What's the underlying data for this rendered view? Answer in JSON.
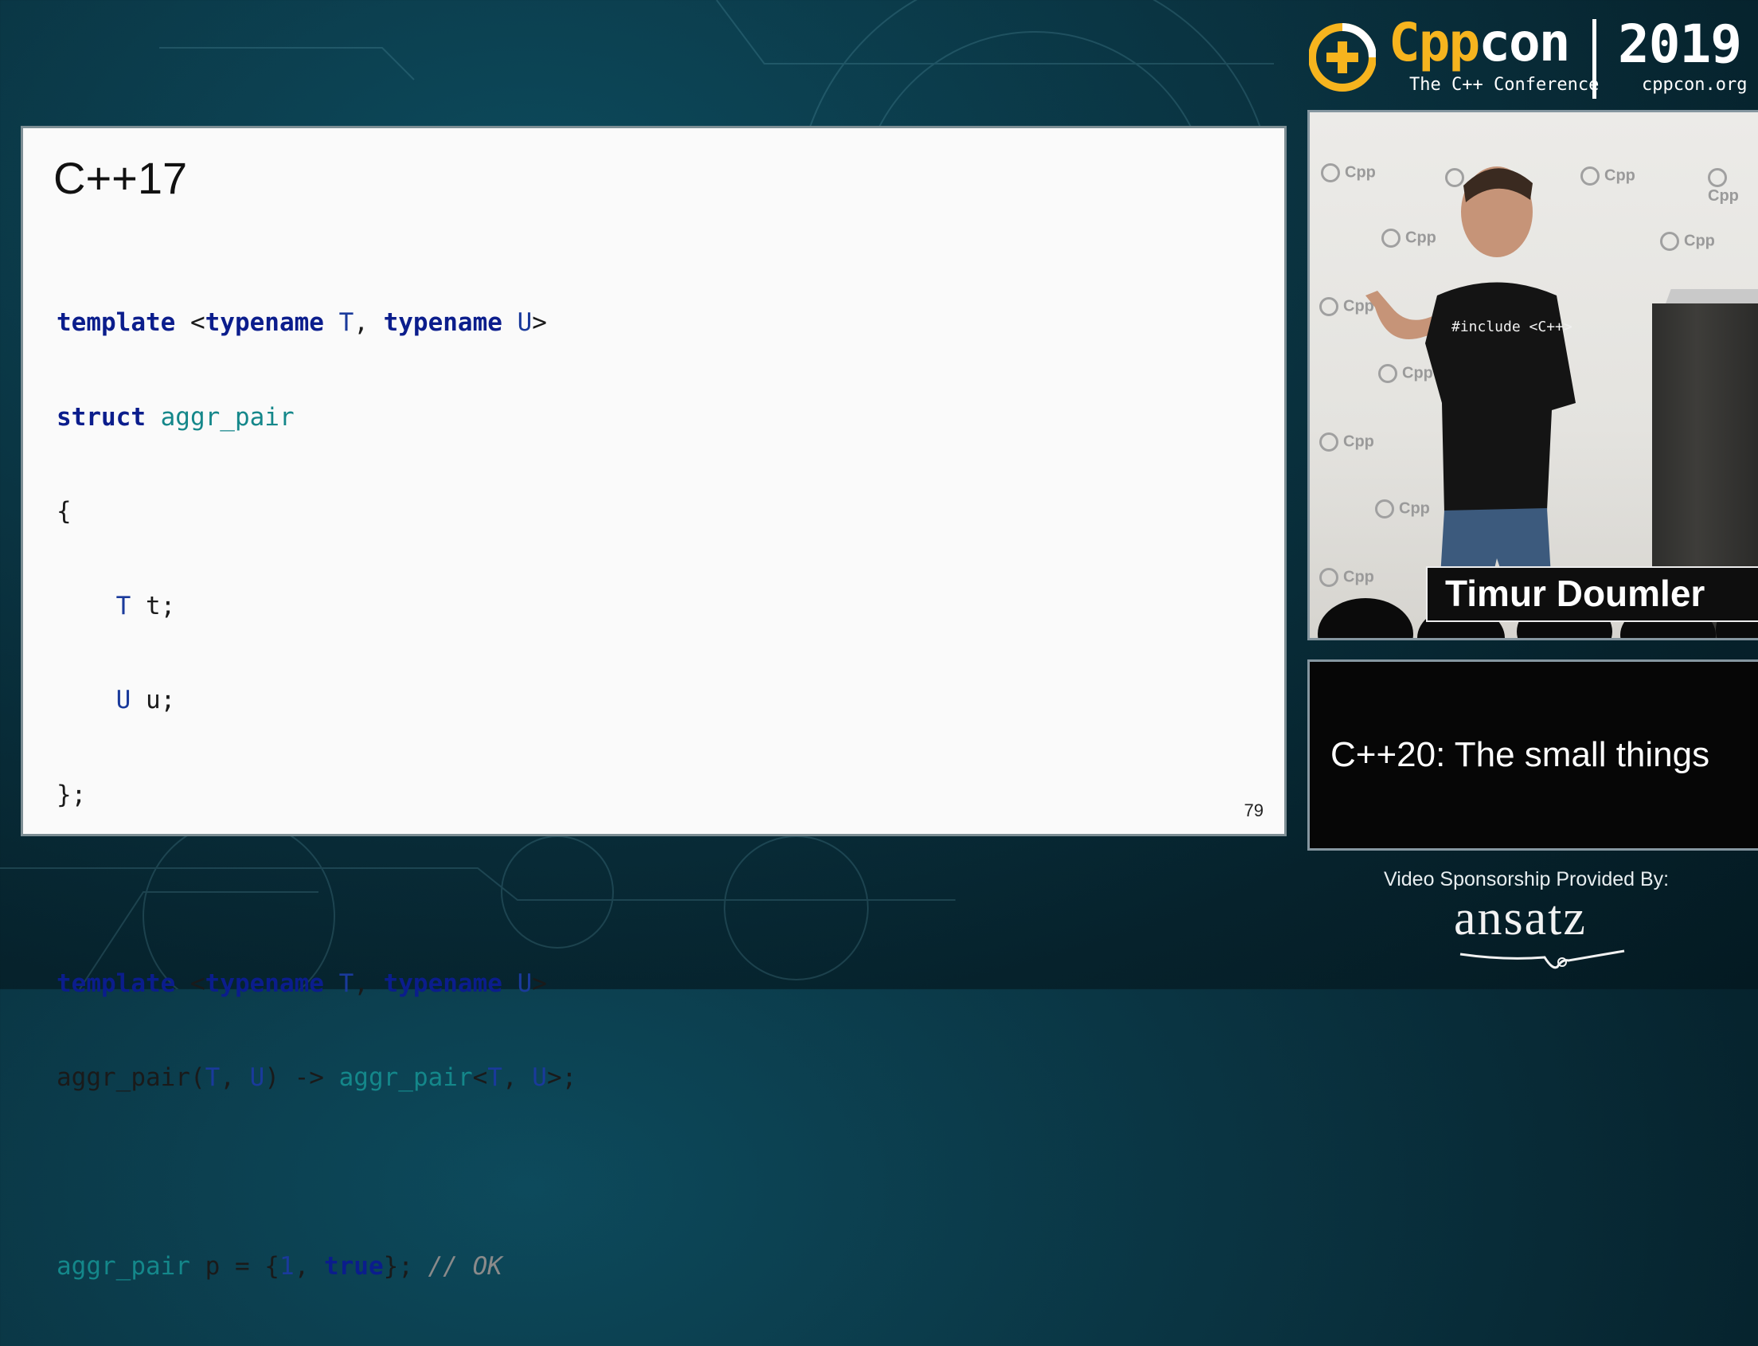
{
  "header": {
    "logo_cpp": "Cpp",
    "logo_con": "con",
    "logo_subtitle": "The C++ Conference",
    "year": "2019",
    "url": "cppcon.org"
  },
  "slide": {
    "title": "C++17",
    "page_number": "79",
    "code": {
      "l1_kw1": "template",
      "l1_a": " <",
      "l1_kw2": "typename",
      "l1_t": " T",
      "l1_b": ", ",
      "l1_kw3": "typename",
      "l1_u": " U",
      "l1_c": ">",
      "l2_kw": "struct",
      "l2_name": " aggr_pair",
      "l3": "{",
      "l4_t": "    T",
      "l4_rest": " t;",
      "l5_u": "    U",
      "l5_rest": " u;",
      "l6": "};",
      "l8_kw1": "template",
      "l8_a": " <",
      "l8_kw2": "typename",
      "l8_t": " T",
      "l8_b": ", ",
      "l8_kw3": "typename",
      "l8_u": " U",
      "l8_c": ">",
      "l9_a": "aggr_pair(",
      "l9_t": "T",
      "l9_b": ", ",
      "l9_u": "U",
      "l9_c": ") -> ",
      "l9_name": "aggr_pair",
      "l9_d": "<",
      "l9_t2": "T",
      "l9_e": ", ",
      "l9_u2": "U",
      "l9_f": ">;",
      "l11_name": "aggr_pair",
      "l11_a": " p = {",
      "l11_num": "1",
      "l11_b": ", ",
      "l11_kw": "true",
      "l11_c": "}; ",
      "l11_cm": "// OK"
    }
  },
  "speaker": {
    "name": "Timur Doumler",
    "shirt_text": "#include <C++>",
    "watermark": "Cpp"
  },
  "talk": {
    "title": "C++20: The small things"
  },
  "sponsor": {
    "label": "Video Sponsorship Provided By:",
    "name": "ansatz"
  },
  "colors": {
    "accent_yellow": "#f6b41e",
    "background_teal": "#0a3442",
    "keyword_blue": "#0b1d8c",
    "typename_teal": "#14878a"
  }
}
